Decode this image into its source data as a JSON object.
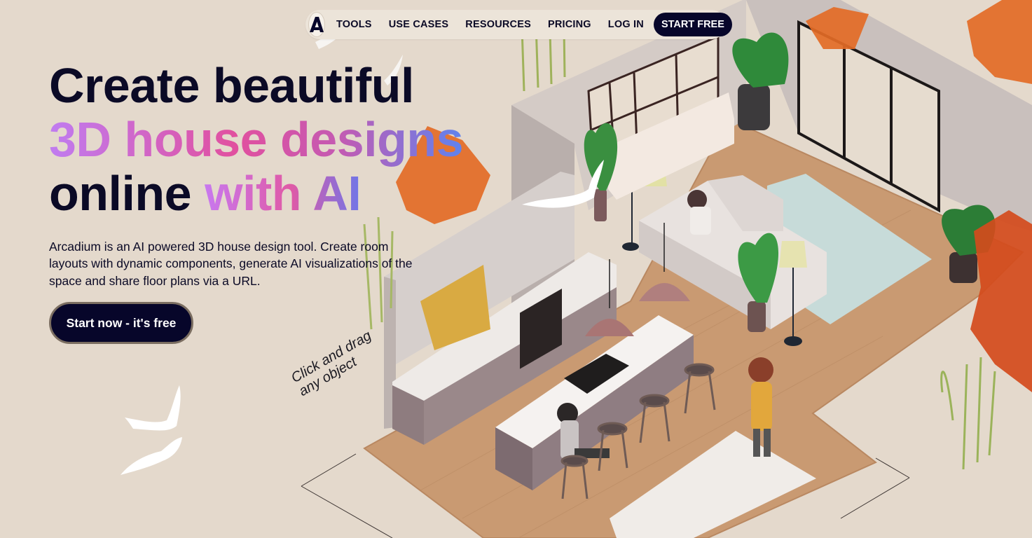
{
  "nav": {
    "logo_icon": "arcadium-logo-icon",
    "items": [
      "TOOLS",
      "USE CASES",
      "RESOURCES",
      "PRICING",
      "LOG IN"
    ],
    "cta_label": "START FREE"
  },
  "hero": {
    "line1": "Create beautiful",
    "line2": "3D house designs",
    "line3_plain": "online ",
    "line3_accent": "with AI",
    "description": "Arcadium is an AI powered 3D house design tool. Create room layouts with dynamic components, generate AI visualizations of the space and share floor plans via a URL.",
    "cta_label": "Start now - it's free",
    "hint": [
      "Click and drag",
      "any object"
    ]
  },
  "colors": {
    "background": "#e4d9cc",
    "text": "#0b0a26",
    "button": "#07062a",
    "gradient_pink": "#e1509f",
    "gradient_purple": "#c07cf0",
    "gradient_blue": "#5e83ee"
  },
  "icons": [
    "arcadium-logo-icon",
    "bird-icon"
  ]
}
